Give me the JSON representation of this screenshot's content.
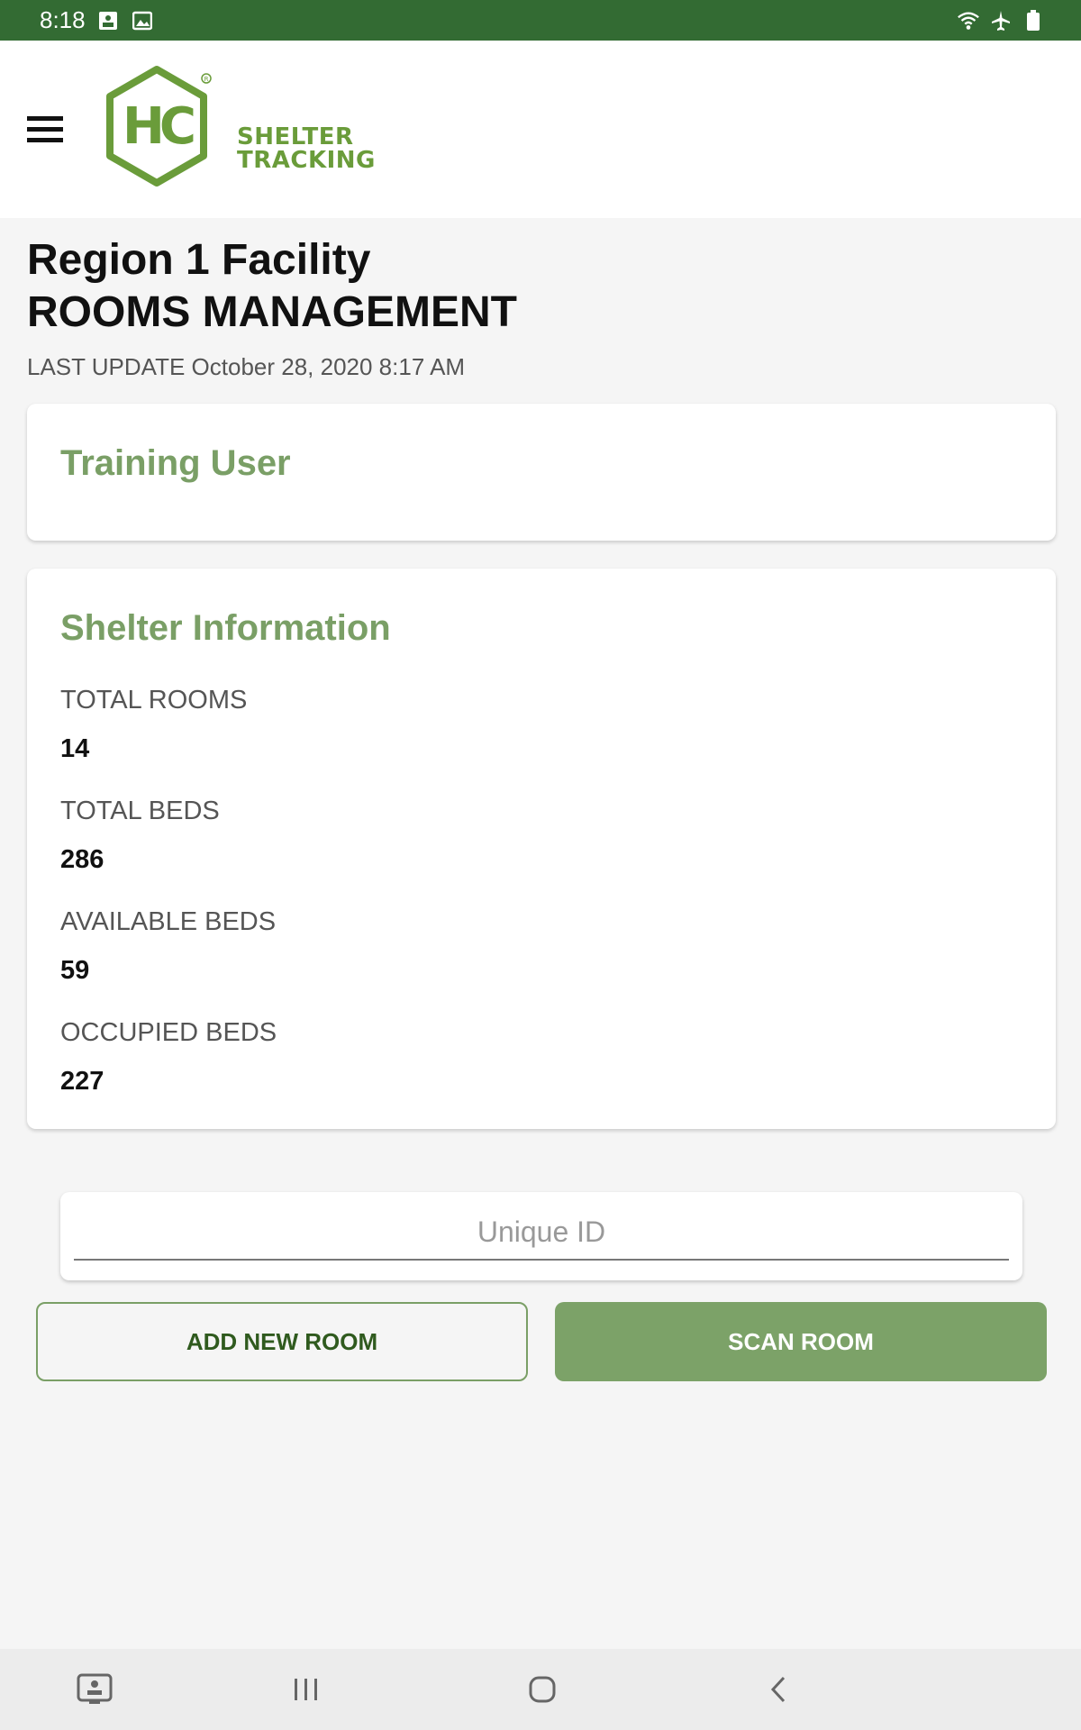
{
  "status_bar": {
    "time": "8:18",
    "icons": [
      "notification-image-icon",
      "gallery-icon",
      "wifi-icon",
      "airplane-icon",
      "battery-icon"
    ]
  },
  "app_bar": {
    "logo_text_line1": "SHELTER",
    "logo_text_line2": "TRACKING",
    "logo_mark": "HC",
    "brand_color": "#6a9c3a"
  },
  "header": {
    "facility": "Region 1 Facility",
    "title": "ROOMS MANAGEMENT",
    "last_update": "LAST UPDATE October 28, 2020 8:17 AM"
  },
  "user_card": {
    "name": "Training User"
  },
  "shelter_card": {
    "title": "Shelter Information",
    "stats": [
      {
        "label": "TOTAL ROOMS",
        "value": "14"
      },
      {
        "label": "TOTAL BEDS",
        "value": "286"
      },
      {
        "label": "AVAILABLE BEDS",
        "value": "59"
      },
      {
        "label": "OCCUPIED BEDS",
        "value": "227"
      }
    ]
  },
  "unique_id": {
    "value": "",
    "placeholder": "Unique ID"
  },
  "actions": {
    "add_label": "ADD NEW ROOM",
    "scan_label": "SCAN ROOM"
  },
  "colors": {
    "status_bar": "#336b33",
    "accent": "#7ca268",
    "card_title": "#7a9f66"
  },
  "nav_bar": {
    "icons": [
      "screenshot-icon",
      "recent-apps-icon",
      "home-icon",
      "back-icon"
    ]
  }
}
